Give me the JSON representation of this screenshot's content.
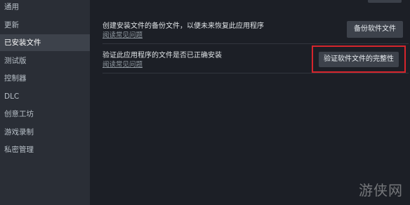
{
  "sidebar": {
    "items": [
      {
        "label": "通用"
      },
      {
        "label": "更新"
      },
      {
        "label": "已安装文件"
      },
      {
        "label": "测试版"
      },
      {
        "label": "控制器"
      },
      {
        "label": "DLC"
      },
      {
        "label": "创意工坊"
      },
      {
        "label": "游戏录制"
      },
      {
        "label": "私密管理"
      }
    ],
    "active_item": "已安装文件"
  },
  "main": {
    "backup": {
      "title": "创建安装文件的备份文件，以便未来恢复此应用程序",
      "link": "阅读常见问题",
      "button": "备份软件文件"
    },
    "verify": {
      "title": "验证此应用程序的文件是否已正确安装",
      "link": "阅读常见问题",
      "button": "验证软件文件的完整性"
    }
  },
  "watermark": "游侠网",
  "colors": {
    "highlight_box": "#d6252c",
    "active_nav_bg": "#3d424b"
  }
}
